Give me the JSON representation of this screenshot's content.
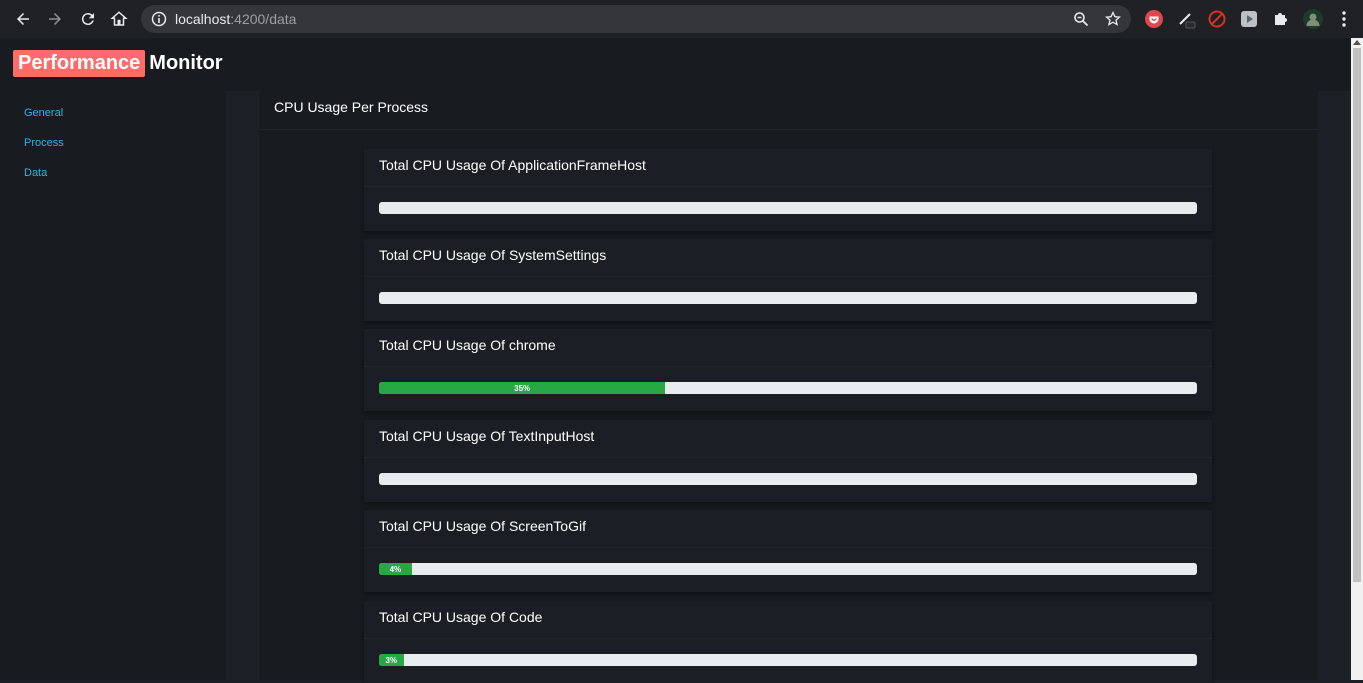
{
  "browser": {
    "url_host": "localhost",
    "url_rest": ":4200/data"
  },
  "app": {
    "brand_highlight": "Performance",
    "brand_rest": "Monitor"
  },
  "sidebar": {
    "items": [
      {
        "label": "General"
      },
      {
        "label": "Process"
      },
      {
        "label": "Data"
      }
    ]
  },
  "main": {
    "title": "CPU Usage Per Process",
    "processes": [
      {
        "title": "Total CPU Usage Of ApplicationFrameHost",
        "percent": 0,
        "label": ""
      },
      {
        "title": "Total CPU Usage Of SystemSettings",
        "percent": 0,
        "label": ""
      },
      {
        "title": "Total CPU Usage Of chrome",
        "percent": 35,
        "label": "35%"
      },
      {
        "title": "Total CPU Usage Of TextInputHost",
        "percent": 0,
        "label": ""
      },
      {
        "title": "Total CPU Usage Of ScreenToGif",
        "percent": 4,
        "label": "4%"
      },
      {
        "title": "Total CPU Usage Of Code",
        "percent": 3,
        "label": "3%"
      }
    ]
  },
  "colors": {
    "brand_accent": "#ff6b6b",
    "link": "#37aee6",
    "progress": "#28a745",
    "progress_track": "#e9ecef"
  }
}
